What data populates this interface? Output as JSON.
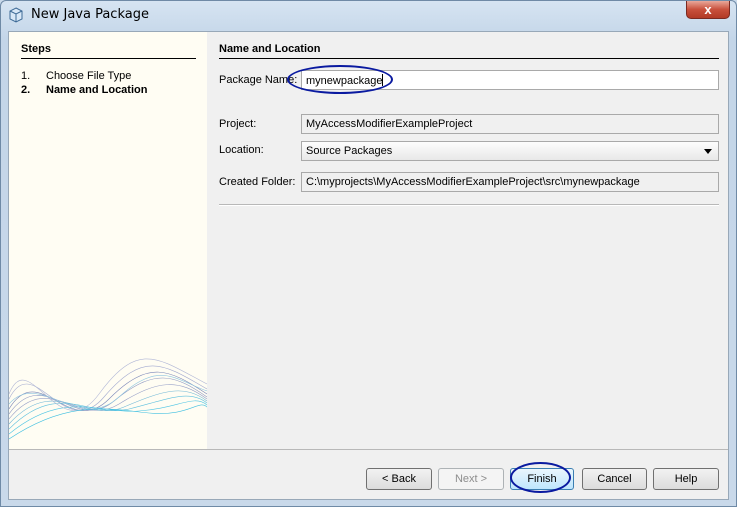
{
  "window": {
    "title": "New Java Package",
    "close_glyph": "x"
  },
  "steps": {
    "title": "Steps",
    "items": [
      {
        "num": "1.",
        "label": "Choose File Type"
      },
      {
        "num": "2.",
        "label": "Name and Location"
      }
    ]
  },
  "form": {
    "title": "Name and Location",
    "package_name_label": "Package Name:",
    "package_name_value": "mynewpackage",
    "project_label": "Project:",
    "project_value": "MyAccessModifierExampleProject",
    "location_label": "Location:",
    "location_value": "Source Packages",
    "created_folder_label": "Created Folder:",
    "created_folder_value": "C:\\myprojects\\MyAccessModifierExampleProject\\src\\mynewpackage"
  },
  "buttons": {
    "back": "< Back",
    "next": "Next >",
    "finish": "Finish",
    "cancel": "Cancel",
    "help": "Help"
  },
  "colors": {
    "annotation": "#0a1aa0",
    "steps_bg": "#fffdf3",
    "dialog_bg": "#f0f0f0"
  }
}
